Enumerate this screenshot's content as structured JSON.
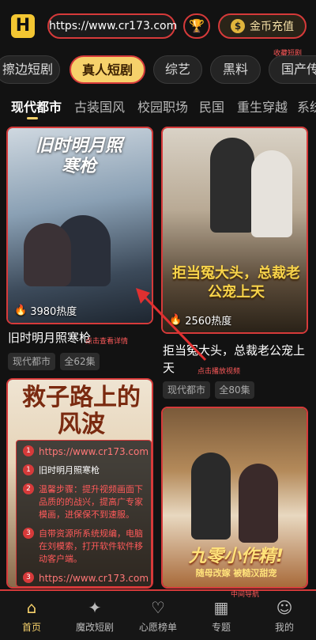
{
  "header": {
    "logo": "H",
    "url": "https://www.cr173.com",
    "coin_button": "金币充值",
    "coin_icon": "$"
  },
  "categories": [
    {
      "label": "擦边短剧"
    },
    {
      "label": "真人短剧"
    },
    {
      "label": "综艺"
    },
    {
      "label": "黑料"
    },
    {
      "label": "国产传"
    }
  ],
  "subtabs": [
    {
      "label": "现代都市"
    },
    {
      "label": "古装国风"
    },
    {
      "label": "校园职场"
    },
    {
      "label": "民国"
    },
    {
      "label": "重生穿越"
    },
    {
      "label": "系统"
    }
  ],
  "cards": [
    {
      "poster_title": "旧时明月照寒枪",
      "hot": "3980热度",
      "title": "旧时明月照寒枪",
      "tags": [
        "现代都市",
        "全62集"
      ]
    },
    {
      "poster_title": "拒当冤大头，总裁老公宠上天",
      "hot": "2560热度",
      "title": "拒当冤大头，总裁老公宠上天",
      "tags": [
        "现代都市",
        "全80集"
      ]
    },
    {
      "poster_title": "救子路上的风波"
    },
    {
      "poster_title": "九零小作精!",
      "poster_sub": "随母改嫁 被糙汉甜宠"
    }
  ],
  "guide": {
    "url_top": "https://www.cr173.com",
    "item1": "旧时明月照寒枪",
    "item2": "温馨步骤：提升视频画面下品质的的战兴，提高广专家模画，进保保不到速服。",
    "item3": "自带资源所系统规编，电脑在刘模索，打开软件软件移动客户端。",
    "url_bottom": "https://www.cr173.com"
  },
  "annotations": {
    "favorite_label": "收藏短剧",
    "card1_note": "点击查看详情",
    "card2_note": "点击播放视频",
    "nav_note": "中间导航"
  },
  "nav": [
    {
      "label": "首页",
      "icon": "home-icon"
    },
    {
      "label": "魔改短剧",
      "icon": "sparkle-icon"
    },
    {
      "label": "心愿榜单",
      "icon": "heart-icon"
    },
    {
      "label": "专题",
      "icon": "grid-icon"
    },
    {
      "label": "我的",
      "icon": "user-icon"
    }
  ],
  "colors": {
    "accent": "#f6d16b",
    "annotation": "#d63a3a",
    "background": "#121212"
  }
}
